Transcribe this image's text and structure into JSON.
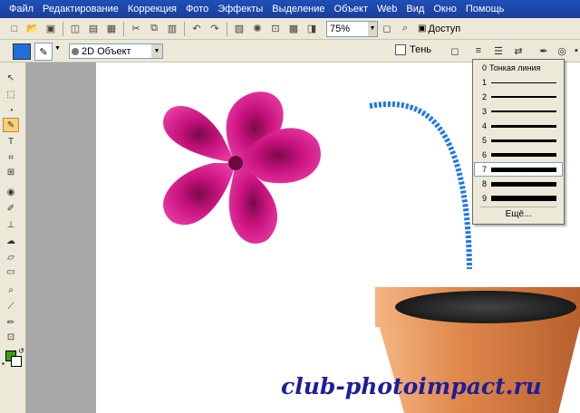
{
  "menubar": {
    "items": [
      "Файл",
      "Редактирование",
      "Коррекция",
      "Фото",
      "Эффекты",
      "Выделение",
      "Объект",
      "Web",
      "Вид",
      "Окно",
      "Помощь"
    ]
  },
  "toolbar": {
    "zoom_value": "75%",
    "access_label": "Доступ"
  },
  "attributes": {
    "fill_color": "#1e6fdc",
    "object_mode": "2D Объект",
    "shadow_label": "Тень"
  },
  "line_width_menu": {
    "thin_label": "Тонкая линия",
    "items": [
      {
        "num": "0",
        "width": 0
      },
      {
        "num": "1",
        "width": 1
      },
      {
        "num": "2",
        "width": 2
      },
      {
        "num": "3",
        "width": 2
      },
      {
        "num": "4",
        "width": 3
      },
      {
        "num": "5",
        "width": 3
      },
      {
        "num": "6",
        "width": 4
      },
      {
        "num": "7",
        "width": 5
      },
      {
        "num": "8",
        "width": 5
      },
      {
        "num": "9",
        "width": 6
      }
    ],
    "selected": "7",
    "more_label": "Ещё..."
  },
  "palette": {
    "foreground": "#3aa012",
    "background": "#ffffff"
  },
  "canvas": {
    "flower_color": "#d4168c",
    "path_color": "#1e78e8",
    "pot_color": "#d97a44",
    "watermark": "club-photoimpact.ru"
  }
}
